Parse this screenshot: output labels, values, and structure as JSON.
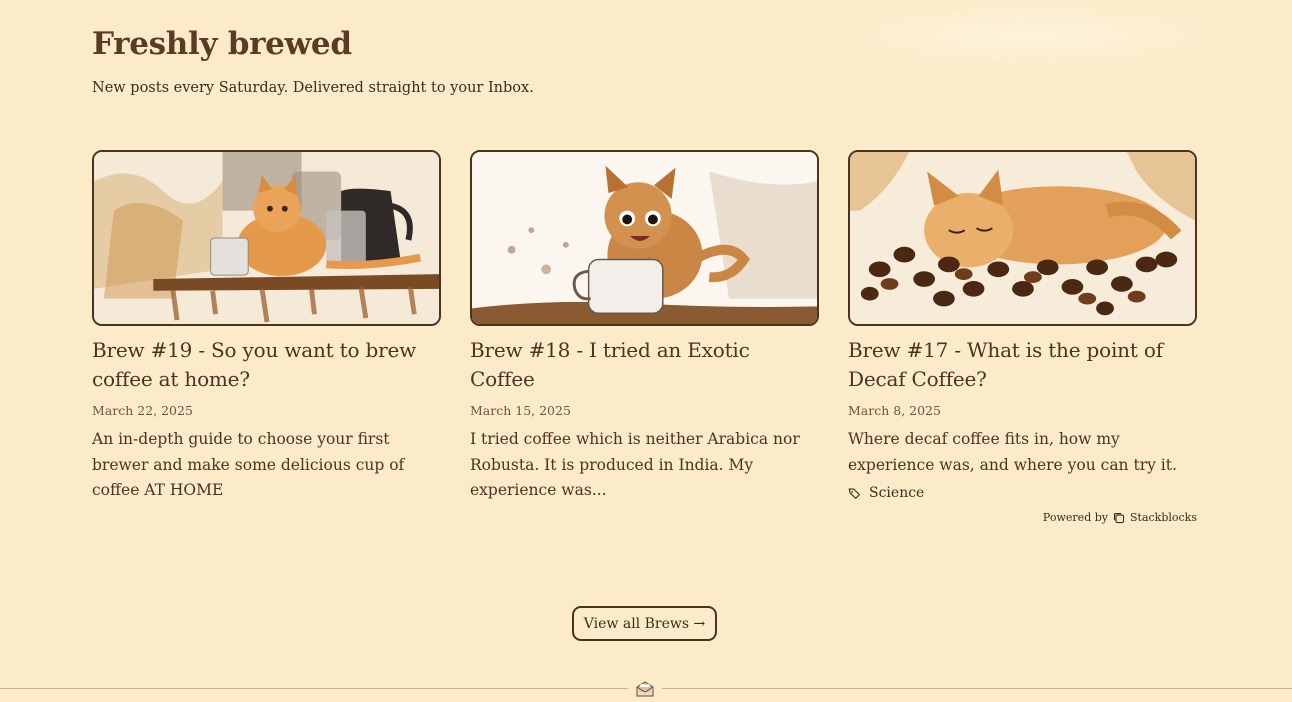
{
  "header": {
    "title": "Freshly brewed",
    "subtitle": "New posts every Saturday. Delivered straight to your Inbox."
  },
  "posts": [
    {
      "title": "Brew #19 - So you want to brew coffee at home?",
      "date": "March 22, 2025",
      "description": "An in-depth guide to choose your first brewer and make some delicious cup of coffee AT HOME",
      "image": "kitten-with-kettle-illustration"
    },
    {
      "title": "Brew #18 - I tried an Exotic Coffee",
      "date": "March 15, 2025",
      "description": "I tried coffee which is neither Arabica nor Robusta. It is produced in India. My experience was...",
      "image": "kitten-with-cup-illustration"
    },
    {
      "title": "Brew #17 - What is the point of Decaf Coffee?",
      "date": "March 8, 2025",
      "description": "Where decaf coffee fits in, how my experience was, and where you can try it.",
      "tag": "Science",
      "image": "kitten-sleeping-on-beans-illustration"
    }
  ],
  "footer": {
    "powered_by_prefix": "Powered by",
    "powered_by_brand": "Stackblocks",
    "view_all_label": "View all Brews →"
  },
  "icons": {
    "tag": "tag-icon",
    "brand": "stackblocks-logo-icon",
    "divider": "envelope-icon"
  },
  "colors": {
    "background": "#fcebc9",
    "text": "#4a3322",
    "border": "#4a3322"
  }
}
